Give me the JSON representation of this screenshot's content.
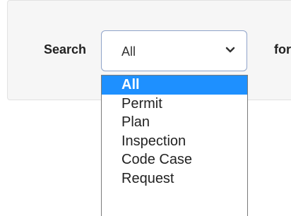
{
  "search": {
    "label": "Search",
    "suffix_label": "for",
    "selected_value": "All",
    "chevron_icon": "chevron-down-icon",
    "options": [
      {
        "label": "All",
        "selected": true
      },
      {
        "label": "Permit",
        "selected": false
      },
      {
        "label": "Plan",
        "selected": false
      },
      {
        "label": "Inspection",
        "selected": false
      },
      {
        "label": "Code Case",
        "selected": false
      },
      {
        "label": "Request",
        "selected": false
      }
    ]
  },
  "colors": {
    "panel_background": "#f6f6f6",
    "select_border": "#8fa3c9",
    "highlight": "#1e90ff"
  }
}
